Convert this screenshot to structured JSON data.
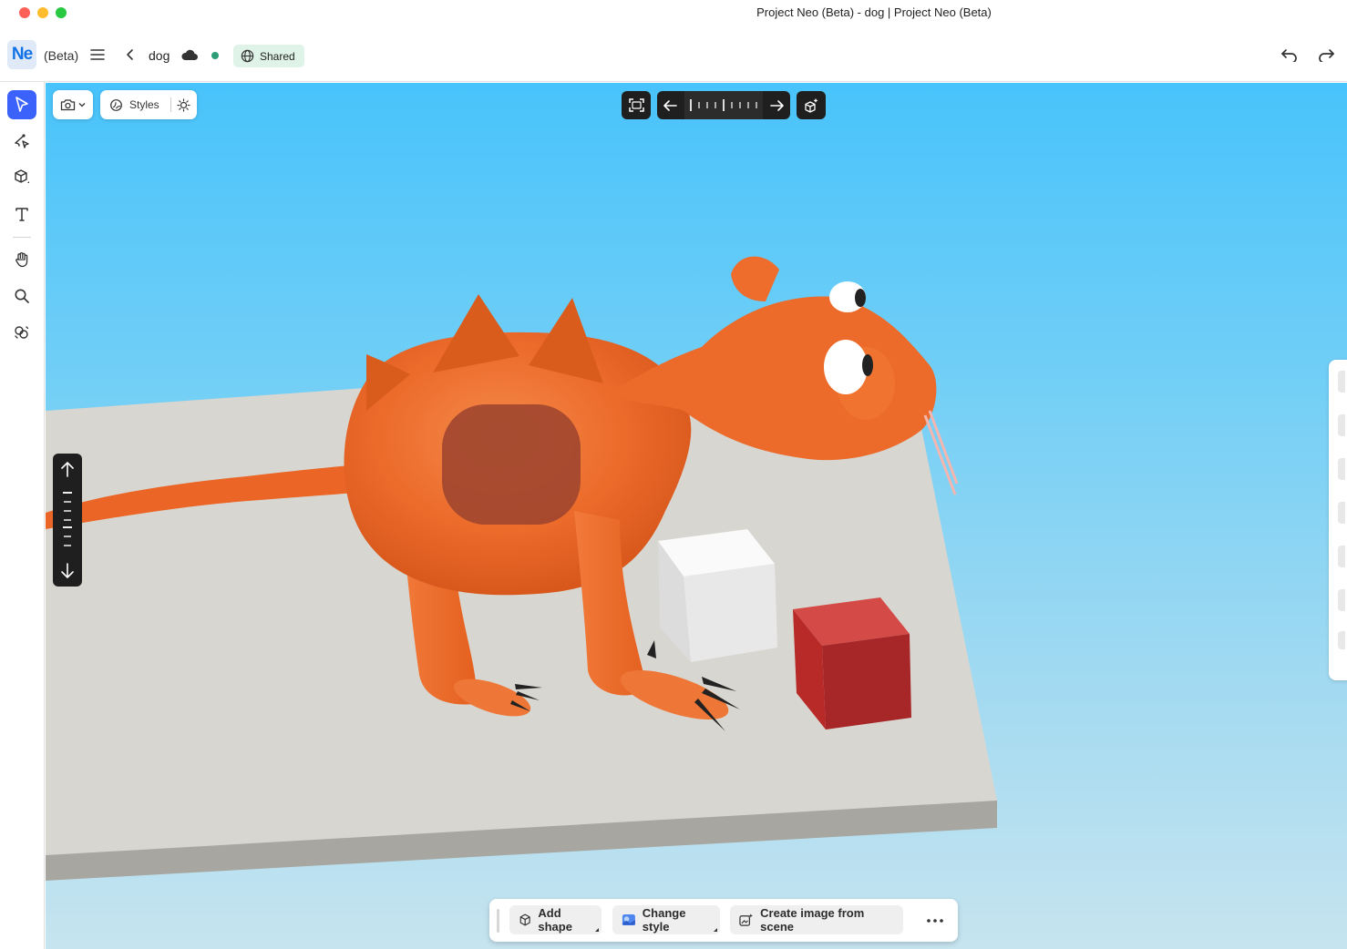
{
  "window": {
    "title": "Project Neo (Beta) - dog | Project Neo (Beta)"
  },
  "header": {
    "logo": "Ne",
    "beta_label": "(Beta)",
    "doc_name": "dog",
    "shared_label": "Shared"
  },
  "toolbar": {
    "styles_label": "Styles"
  },
  "actions": {
    "add_shape": "Add shape",
    "change_style": "Change style",
    "create_image": "Create image from scene"
  },
  "colors": {
    "accent": "#3b63fb",
    "sky": "#48c3fb",
    "dog": "#f06a2a",
    "floor": "#d8d6d0",
    "white_cube": "#ececec",
    "red_cube": "#c9302f",
    "status_dot": "#2d9d78"
  },
  "icons": {
    "menu": "hamburger-icon",
    "back": "chevron-left-icon",
    "cloud": "cloud-icon",
    "undo": "undo-icon",
    "redo": "redo-icon"
  }
}
